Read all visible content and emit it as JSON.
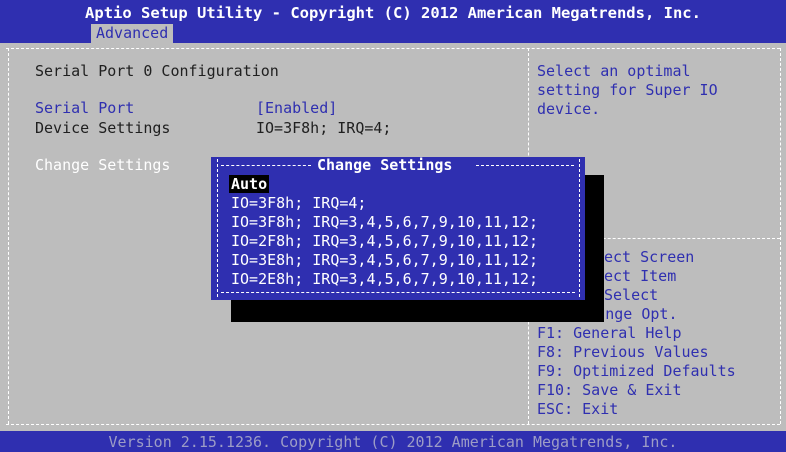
{
  "header": {
    "title": "Aptio Setup Utility - Copyright (C) 2012 American Megatrends, Inc.",
    "active_tab": "Advanced"
  },
  "main": {
    "section_title": "Serial Port 0 Configuration",
    "rows": [
      {
        "label": "Serial Port",
        "value": "[Enabled]"
      },
      {
        "label": "Device Settings",
        "value": "IO=3F8h; IRQ=4;"
      }
    ],
    "change_settings_label": "Change Settings"
  },
  "help": {
    "lines": [
      "Select an optimal",
      "setting for Super IO",
      "device."
    ]
  },
  "keys": [
    "ect Screen",
    "ect Item",
    "Select",
    "+/-: Change Opt.",
    "F1: General Help",
    "F8: Previous Values",
    "F9: Optimized Defaults",
    "F10: Save & Exit",
    "ESC: Exit"
  ],
  "popup": {
    "title": "Change Settings",
    "options": [
      "Auto",
      "IO=3F8h; IRQ=4;",
      "IO=3F8h; IRQ=3,4,5,6,7,9,10,11,12;",
      "IO=2F8h; IRQ=3,4,5,6,7,9,10,11,12;",
      "IO=3E8h; IRQ=3,4,5,6,7,9,10,11,12;",
      "IO=2E8h; IRQ=3,4,5,6,7,9,10,11,12;"
    ],
    "selected_index": 0
  },
  "footer": {
    "version": "Version 2.15.1236. Copyright (C) 2012 American Megatrends, Inc."
  },
  "colors": {
    "background": "#bdbdbd",
    "bar": "#2f2fb0",
    "popup": "#2f2fb0",
    "text_dark": "#202020",
    "text_blue": "#2f2fb0",
    "text_white": "#ffffff"
  }
}
